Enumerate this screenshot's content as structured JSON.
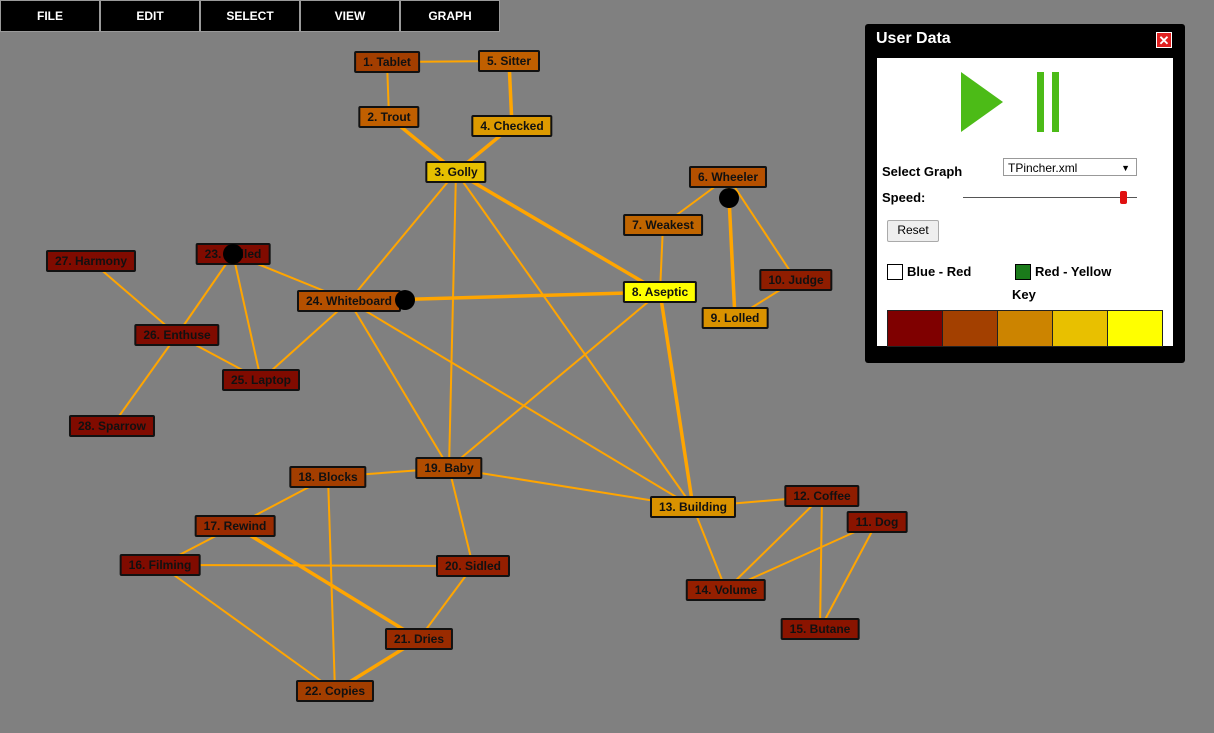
{
  "menu": [
    {
      "label": "FILE",
      "name": "menu-file"
    },
    {
      "label": "EDIT",
      "name": "menu-edit"
    },
    {
      "label": "SELECT",
      "name": "menu-select"
    },
    {
      "label": "VIEW",
      "name": "menu-view"
    },
    {
      "label": "GRAPH",
      "name": "menu-graph"
    }
  ],
  "colors": {
    "background": "#808080",
    "edge": "#ffa500",
    "key": [
      "#7f0000",
      "#a34000",
      "#cc8400",
      "#e8c000",
      "#ffff00"
    ]
  },
  "graph": {
    "nodes": [
      {
        "id": 1,
        "label": "1. Tablet",
        "color": "#a33e00"
      },
      {
        "id": 2,
        "label": "2. Trout",
        "color": "#c05f00"
      },
      {
        "id": 3,
        "label": "3. Golly",
        "color": "#e6c000"
      },
      {
        "id": 4,
        "label": "4. Checked",
        "color": "#dd9a00"
      },
      {
        "id": 5,
        "label": "5. Sitter",
        "color": "#c05f00"
      },
      {
        "id": 6,
        "label": "6. Wheeler",
        "color": "#b55000"
      },
      {
        "id": 7,
        "label": "7. Weakest",
        "color": "#c06500"
      },
      {
        "id": 8,
        "label": "8. Aseptic",
        "color": "#ffff00"
      },
      {
        "id": 9,
        "label": "9. Lolled",
        "color": "#d99200"
      },
      {
        "id": 10,
        "label": "10. Judge",
        "color": "#8f1d00"
      },
      {
        "id": 11,
        "label": "11. Dog",
        "color": "#8a1400"
      },
      {
        "id": 12,
        "label": "12. Coffee",
        "color": "#8f1d00"
      },
      {
        "id": 13,
        "label": "13. Building",
        "color": "#d99200"
      },
      {
        "id": 14,
        "label": "14. Volume",
        "color": "#951f00"
      },
      {
        "id": 15,
        "label": "15. Butane",
        "color": "#8a1400"
      },
      {
        "id": 16,
        "label": "16. Filming",
        "color": "#800b00"
      },
      {
        "id": 17,
        "label": "17. Rewind",
        "color": "#9a2b00"
      },
      {
        "id": 18,
        "label": "18. Blocks",
        "color": "#a33e00"
      },
      {
        "id": 19,
        "label": "19. Baby",
        "color": "#b04c00"
      },
      {
        "id": 20,
        "label": "20. Sidled",
        "color": "#951f00"
      },
      {
        "id": 21,
        "label": "21. Dries",
        "color": "#9a2b00"
      },
      {
        "id": 22,
        "label": "22. Copies",
        "color": "#a33e00"
      },
      {
        "id": 23,
        "label": "23. Culled",
        "color": "#800b00"
      },
      {
        "id": 24,
        "label": "24. Whiteboard",
        "color": "#b55000"
      },
      {
        "id": 25,
        "label": "25. Laptop",
        "color": "#800b00"
      },
      {
        "id": 26,
        "label": "26. Enthuse",
        "color": "#800b00"
      },
      {
        "id": 27,
        "label": "27. Harmony",
        "color": "#800b00"
      },
      {
        "id": 28,
        "label": "28. Sparrow",
        "color": "#800b00"
      }
    ],
    "edges": [
      [
        1,
        5
      ],
      [
        1,
        2
      ],
      [
        2,
        3
      ],
      [
        5,
        4
      ],
      [
        4,
        3
      ],
      [
        3,
        24
      ],
      [
        3,
        19
      ],
      [
        3,
        13
      ],
      [
        3,
        8
      ],
      [
        7,
        8
      ],
      [
        7,
        6
      ],
      [
        6,
        9
      ],
      [
        6,
        10
      ],
      [
        10,
        9
      ],
      [
        8,
        24
      ],
      [
        8,
        13
      ],
      [
        8,
        19
      ],
      [
        24,
        23
      ],
      [
        24,
        25
      ],
      [
        24,
        19
      ],
      [
        24,
        13
      ],
      [
        23,
        26
      ],
      [
        23,
        25
      ],
      [
        27,
        26
      ],
      [
        26,
        25
      ],
      [
        26,
        28
      ],
      [
        19,
        18
      ],
      [
        19,
        13
      ],
      [
        19,
        20
      ],
      [
        18,
        17
      ],
      [
        18,
        22
      ],
      [
        17,
        16
      ],
      [
        17,
        21
      ],
      [
        16,
        20
      ],
      [
        16,
        22
      ],
      [
        20,
        21
      ],
      [
        21,
        22
      ],
      [
        13,
        12
      ],
      [
        13,
        14
      ],
      [
        12,
        14
      ],
      [
        12,
        15
      ],
      [
        11,
        14
      ],
      [
        11,
        15
      ]
    ]
  },
  "panel": {
    "title": "User Data",
    "close": "✕",
    "select_graph_label": "Select Graph",
    "graph_file": "TPincher.xml",
    "speed_label": "Speed:",
    "speed_value": 0.92,
    "reset_label": "Reset",
    "blue_red_label": "Blue - Red",
    "blue_red_checked": false,
    "red_yellow_label": "Red - Yellow",
    "red_yellow_checked": true,
    "key_label": "Key"
  }
}
